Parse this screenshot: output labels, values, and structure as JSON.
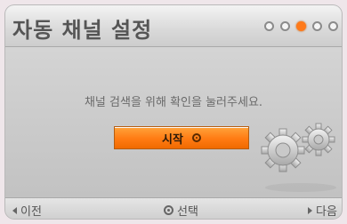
{
  "header": {
    "title": "자동 채널 설정"
  },
  "steps": {
    "total": 5,
    "active": 3
  },
  "main": {
    "message": "채널 검색을 위해 확인을 눌러주세요.",
    "start_label": "시작"
  },
  "footer": {
    "prev_label": "이전",
    "select_label": "선택",
    "next_label": "다음"
  },
  "colors": {
    "accent": "#ff7b13",
    "step_active": "#ff7a1a",
    "background": "#c9c9c9"
  },
  "icons": {
    "start": "ok-circle-icon",
    "decor": "gears-icon",
    "prev": "triangle-left-icon",
    "select": "ok-circle-icon",
    "next": "triangle-right-icon"
  }
}
